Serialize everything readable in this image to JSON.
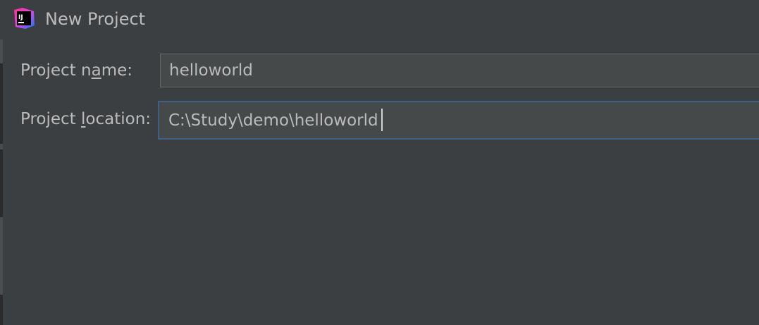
{
  "window": {
    "title": "New Project",
    "icon": "intellij-idea-icon",
    "icon_text": "IJ"
  },
  "form": {
    "name_label": {
      "before": "Project n",
      "mnemonic": "a",
      "after": "me:"
    },
    "name_value": "helloworld",
    "location_label": {
      "before": "Project ",
      "mnemonic": "l",
      "after": "ocation:"
    },
    "location_value": "C:\\Study\\demo\\helloworld"
  },
  "colors": {
    "background": "#3c3f41",
    "text": "#bbbbbb",
    "input_background": "#45494a",
    "focus_border": "#3d6185"
  }
}
